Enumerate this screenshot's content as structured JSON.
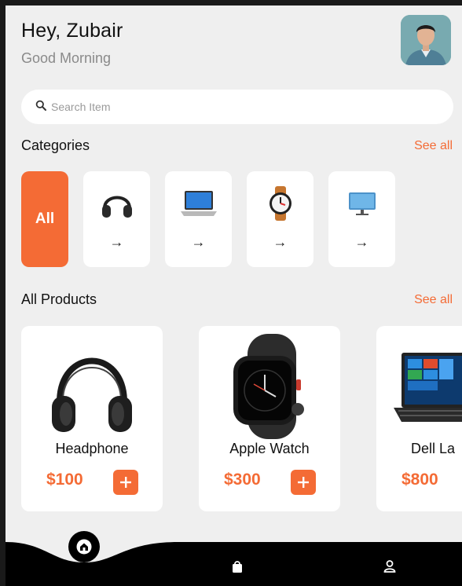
{
  "header": {
    "greeting": "Hey, Zubair",
    "subtitle": "Good Morning"
  },
  "search": {
    "placeholder": "Search Item"
  },
  "categories": {
    "title": "Categories",
    "see_all": "See all",
    "all_label": "All",
    "items": [
      "headphone",
      "laptop",
      "watch",
      "monitor"
    ]
  },
  "products": {
    "title": "All Products",
    "see_all": "See all",
    "items": [
      {
        "name": "Headphone",
        "price": "$100"
      },
      {
        "name": "Apple Watch",
        "price": "$300"
      },
      {
        "name": "Dell La",
        "price": "$800"
      }
    ]
  },
  "colors": {
    "accent": "#f46b35",
    "background": "#efefef",
    "nav": "#000000"
  },
  "icons": {
    "search": "search-icon",
    "home": "home-icon",
    "bag": "bag-icon",
    "profile": "profile-icon",
    "add": "plus-icon",
    "arrow": "arrow-right-icon"
  }
}
